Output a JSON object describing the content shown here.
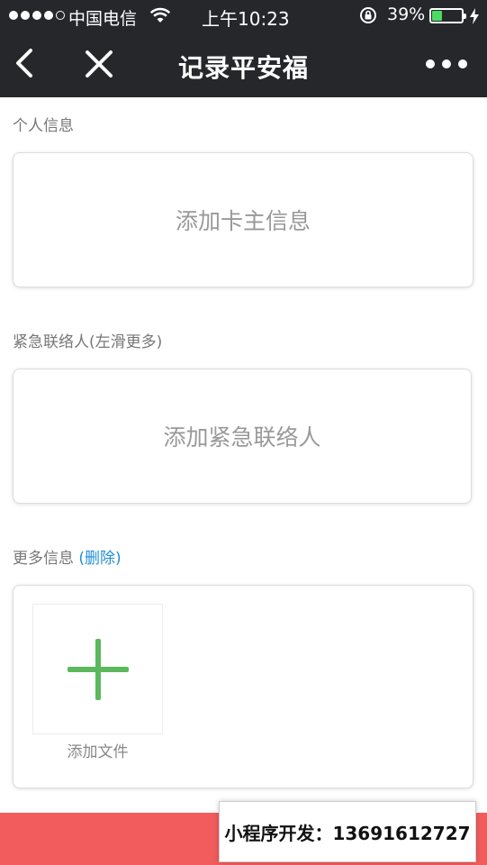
{
  "status_bar": {
    "carrier": "中国电信",
    "time": "上午10:23",
    "battery_percent": "39%",
    "battery_level": 0.39,
    "signal_bars_filled": 4,
    "signal_bars_total": 5,
    "icons": [
      "signal-dots-icon",
      "wifi-icon",
      "rotation-lock-icon",
      "battery-icon",
      "charging-bolt-icon"
    ]
  },
  "nav": {
    "title": "记录平安福",
    "icons": [
      "back-chevron-icon",
      "close-icon",
      "more-dots-icon"
    ]
  },
  "personal_section": {
    "label": "个人信息",
    "card_text": "添加卡主信息"
  },
  "emergency_section": {
    "label": "紧急联络人(左滑更多)",
    "card_text": "添加紧急联络人"
  },
  "more_section": {
    "label": "更多信息",
    "action": "(删除)",
    "upload_label": "添加文件"
  },
  "watermark": {
    "text": "小程序开发：13691612727"
  },
  "colors": {
    "header_bg": "#26272b",
    "battery_green": "#4cd964",
    "link_blue": "#1f8fd6",
    "plus_green": "#5cb85c",
    "bottom_bar_red": "#f25c5c"
  }
}
